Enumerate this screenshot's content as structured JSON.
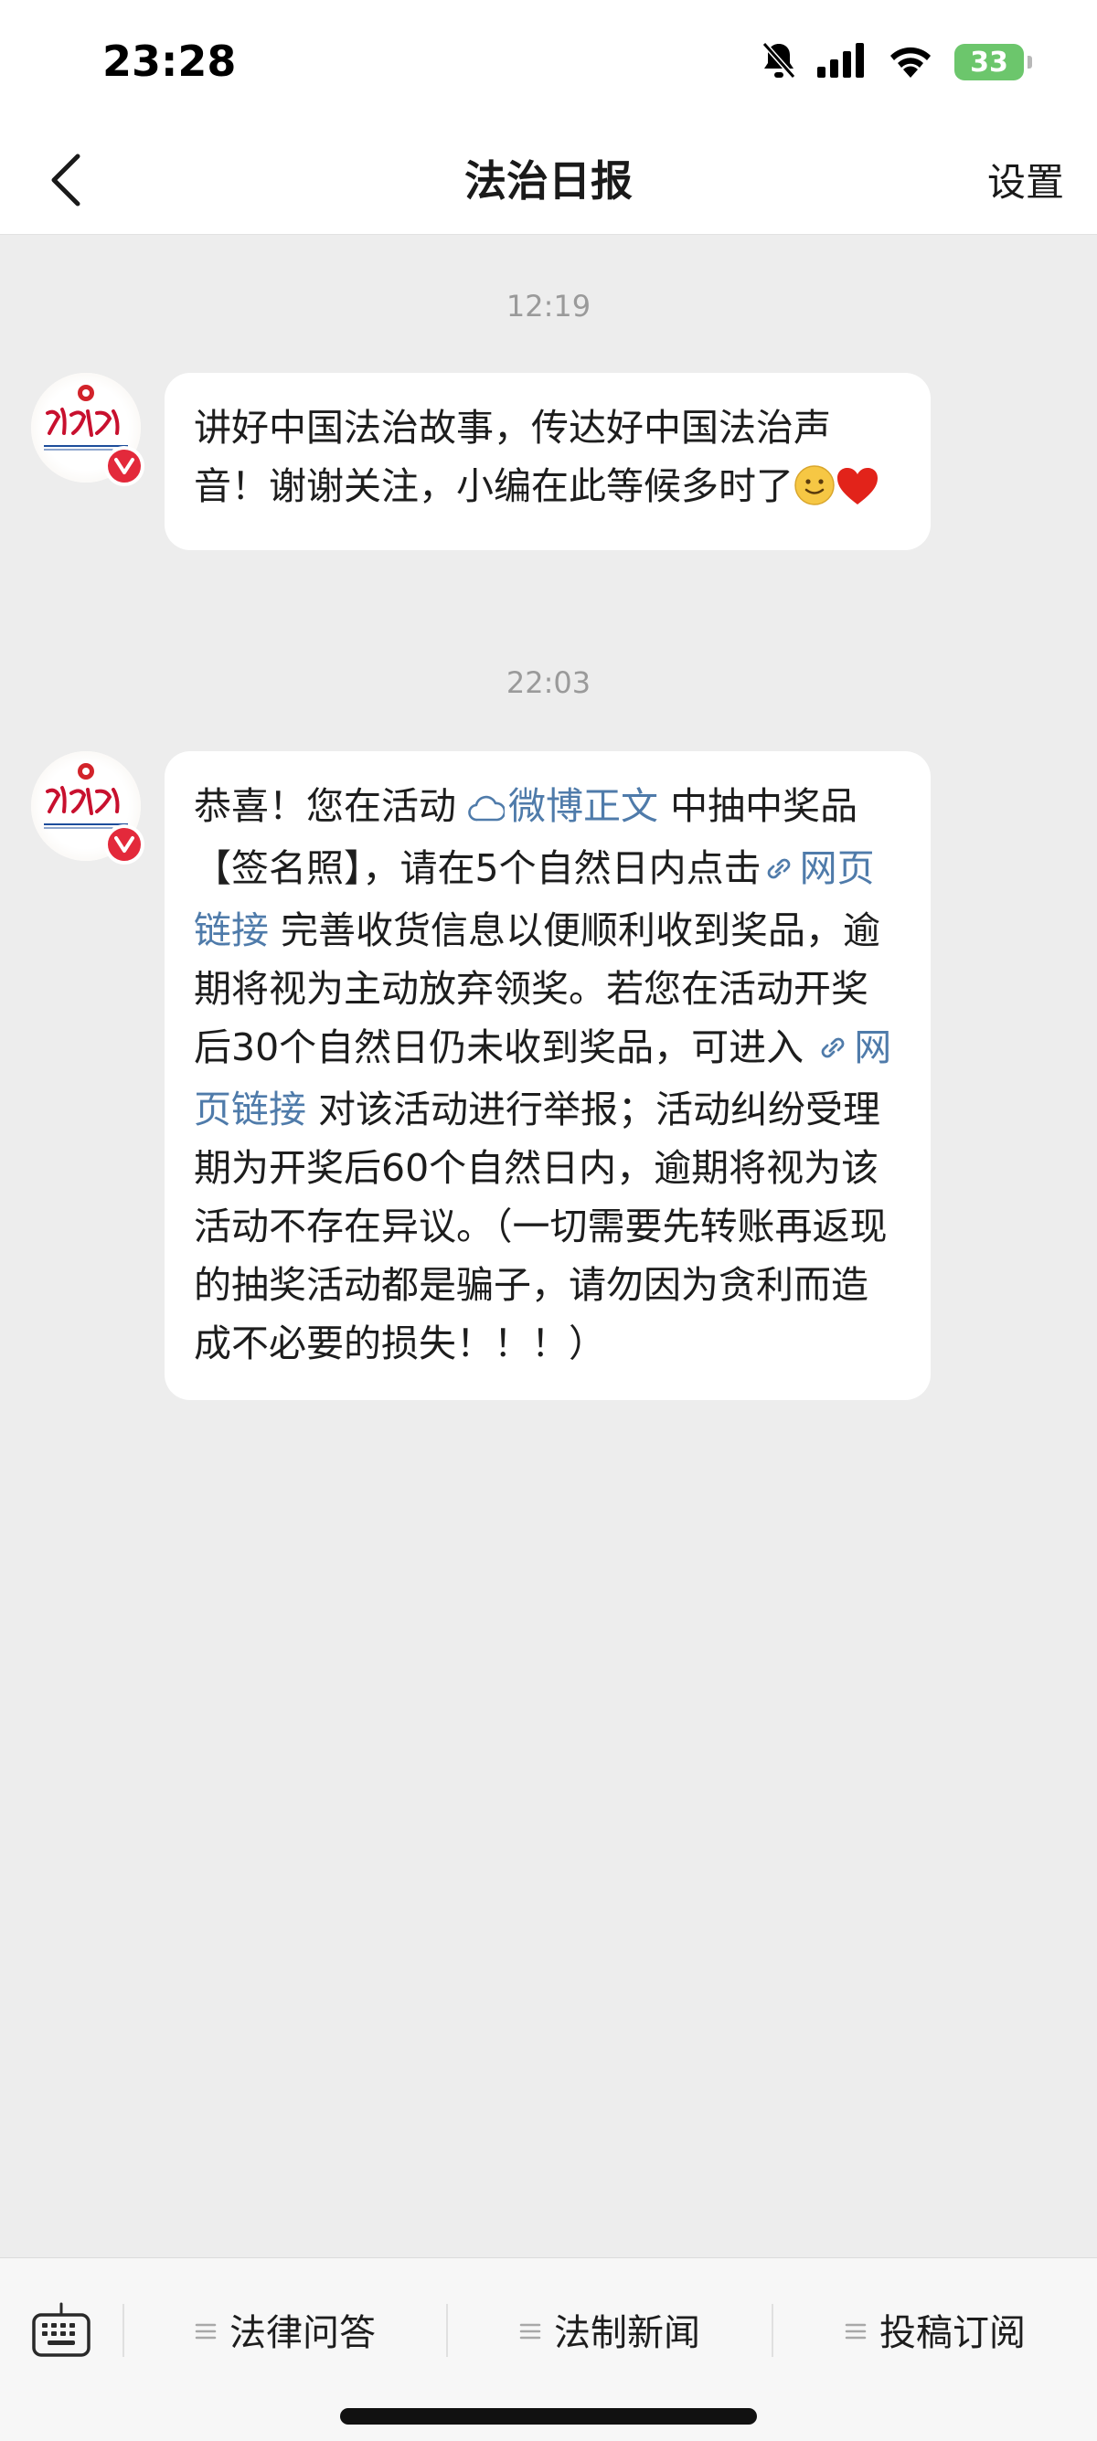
{
  "status_bar": {
    "time": "23:28",
    "battery_level": "33",
    "icons": [
      "bell-muted-icon",
      "signal-icon",
      "wifi-icon",
      "battery-icon"
    ]
  },
  "nav": {
    "title": "法治日报",
    "settings_label": "设置",
    "back_icon": "chevron-left-icon"
  },
  "chat": {
    "messages": [
      {
        "timestamp": "12:19",
        "sender_avatar": "legal-daily-logo",
        "text_parts": [
          "讲好中国法治故事，传达好中国法治声音！谢谢关注，小编在此等候多时了"
        ],
        "emojis": [
          "smile-emoji",
          "red-heart-emoji"
        ]
      },
      {
        "timestamp": "22:03",
        "sender_avatar": "legal-daily-logo",
        "text_parts": [
          "恭喜！您在活动",
          "微博正文",
          "中抽中奖品【签名照】，请在5个自然日内点击",
          "网页链接",
          "完善收货信息以便顺利收到奖品，逾期将视为主动放弃领奖。若您在活动开奖后30个自然日仍未收到奖品，可进入",
          "网页链接",
          "对该活动进行举报；活动纠纷受理期为开奖后60个自然日内，逾期将视为该活动不存在异议。（一切需要先转账再返现的抽奖活动都是骗子，请勿因为贪利而造成不必要的损失！！！）"
        ],
        "links": [
          {
            "label": "微博正文",
            "icon": "weibo-cloud-icon"
          },
          {
            "label": "网页链接",
            "icon": "link-icon"
          },
          {
            "label": "网页链接",
            "icon": "link-icon"
          }
        ]
      }
    ]
  },
  "bottom_menu": {
    "keyboard_icon": "keyboard-icon",
    "items": [
      {
        "label": "法律问答",
        "icon": "menu-lines-icon"
      },
      {
        "label": "法制新闻",
        "icon": "menu-lines-icon"
      },
      {
        "label": "投稿订阅",
        "icon": "menu-lines-icon"
      }
    ]
  },
  "colors": {
    "link": "#4f7baa",
    "background": "#ededed",
    "bubble": "#ffffff",
    "verified_badge": "#e3293b",
    "battery": "#6cc66c"
  }
}
